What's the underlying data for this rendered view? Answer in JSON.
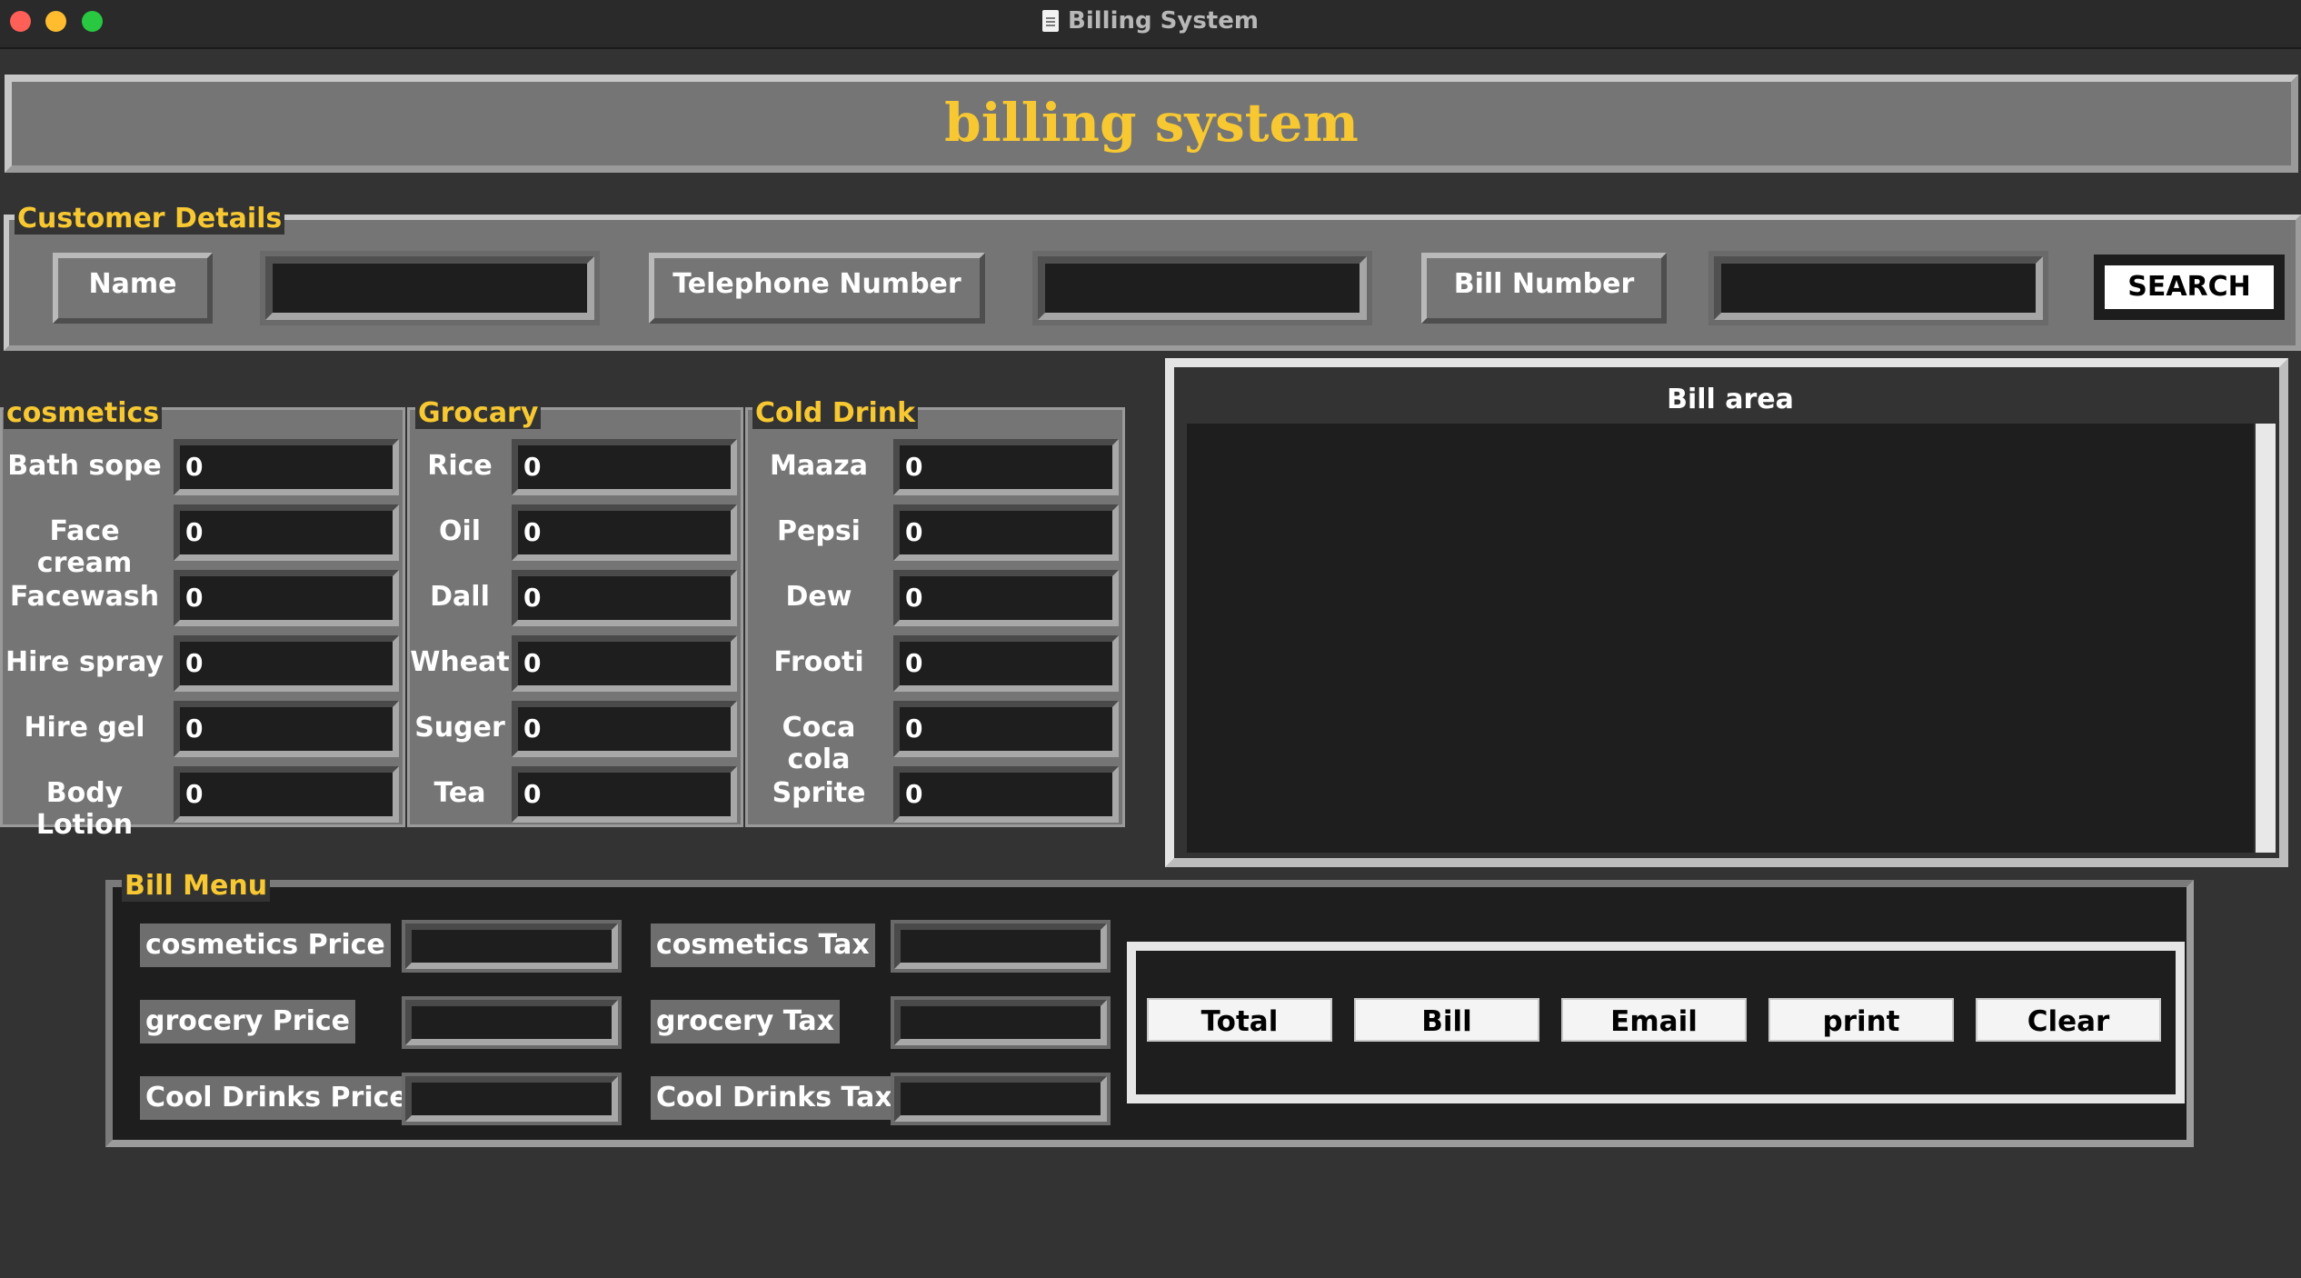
{
  "window": {
    "title": "Billing System"
  },
  "header": {
    "title": "billing system"
  },
  "customer": {
    "legend": "Customer Details",
    "name_label": "Name",
    "name_value": "",
    "phone_label": "Telephone Number",
    "phone_value": "",
    "bill_label": "Bill Number",
    "bill_value": "",
    "search_label": "SEARCH"
  },
  "groups": [
    {
      "title": "cosmetics",
      "items": [
        {
          "label": "Bath sope",
          "value": "0"
        },
        {
          "label": "Face cream",
          "value": "0"
        },
        {
          "label": "Facewash",
          "value": "0"
        },
        {
          "label": "Hire spray",
          "value": "0"
        },
        {
          "label": "Hire gel",
          "value": "0"
        },
        {
          "label": "Body Lotion",
          "value": "0"
        }
      ]
    },
    {
      "title": "Grocary",
      "items": [
        {
          "label": "Rice",
          "value": "0"
        },
        {
          "label": "Oil",
          "value": "0"
        },
        {
          "label": "Dall",
          "value": "0"
        },
        {
          "label": "Wheat",
          "value": "0"
        },
        {
          "label": "Suger",
          "value": "0"
        },
        {
          "label": "Tea",
          "value": "0"
        }
      ]
    },
    {
      "title": "Cold Drink",
      "items": [
        {
          "label": "Maaza",
          "value": "0"
        },
        {
          "label": "Pepsi",
          "value": "0"
        },
        {
          "label": "Dew",
          "value": "0"
        },
        {
          "label": "Frooti",
          "value": "0"
        },
        {
          "label": "Coca cola",
          "value": "0"
        },
        {
          "label": "Sprite",
          "value": "0"
        }
      ]
    }
  ],
  "bill_area": {
    "title": "Bill area",
    "text": ""
  },
  "bill_menu": {
    "legend": "Bill Menu",
    "rows": [
      {
        "price_label": "cosmetics Price",
        "price_value": "",
        "tax_label": "cosmetics Tax",
        "tax_value": ""
      },
      {
        "price_label": "grocery Price",
        "price_value": "",
        "tax_label": "grocery Tax",
        "tax_value": ""
      },
      {
        "price_label": "Cool Drinks Price",
        "price_value": "",
        "tax_label": "Cool Drinks Tax",
        "tax_value": ""
      }
    ],
    "buttons": [
      "Total",
      "Bill",
      "Email",
      "print",
      "Clear"
    ]
  },
  "colors": {
    "accent": "#f7c831",
    "panel": "#757575",
    "background": "#333333",
    "field": "#1e1e1e"
  }
}
